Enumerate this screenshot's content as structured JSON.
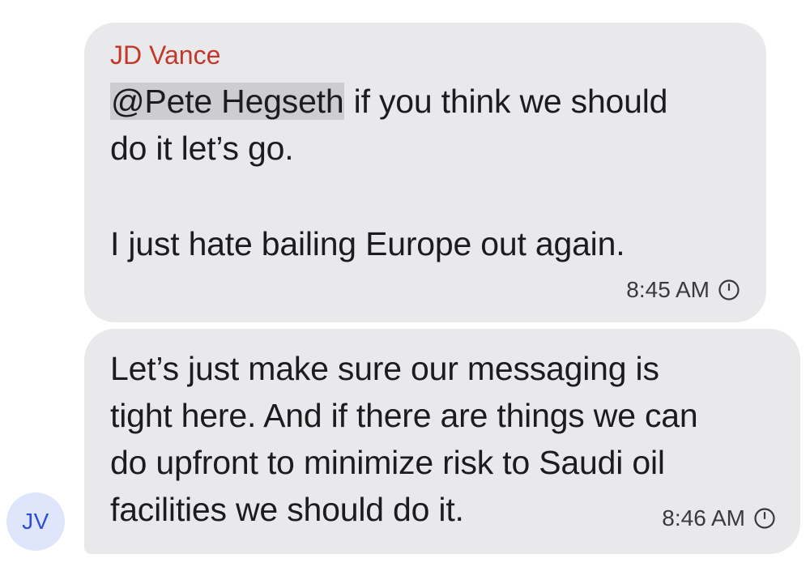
{
  "messages": [
    {
      "sender": "JD Vance",
      "mention": "@Pete Hegseth",
      "line1_rest": " if you think we should",
      "line2": "do it let’s go.",
      "line3": "I just hate bailing Europe out again.",
      "time": "8:45 AM",
      "status_icon": "clock-icon"
    },
    {
      "lines": [
        "Let’s just make sure our messaging is",
        "tight here. And if there are things we can",
        "do upfront to minimize risk to Saudi oil",
        "facilities we should do it."
      ],
      "time": "8:46 AM",
      "status_icon": "clock-icon"
    }
  ],
  "avatar": {
    "initials": "JV"
  },
  "colors": {
    "bubble": "#e9e9eb",
    "sender_name": "#c0392b",
    "mention_highlight": "#cdcdd0",
    "avatar_bg": "#dfe6fb",
    "avatar_text": "#2c4fd6"
  }
}
